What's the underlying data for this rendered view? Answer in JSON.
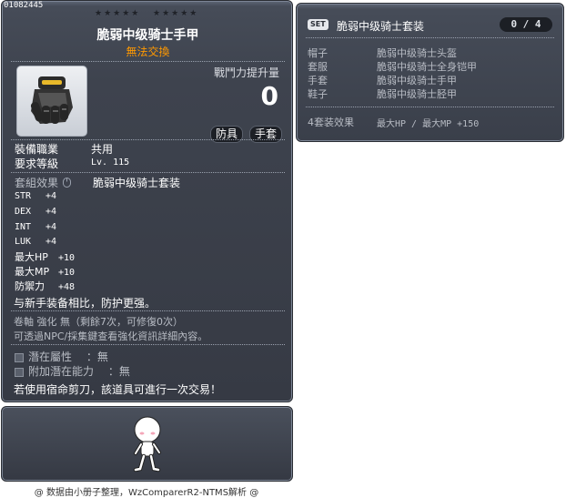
{
  "item_id": "01082445",
  "stars_left": "★★★★★",
  "stars_right": "★★★★★",
  "title": "脆弱中级骑士手甲",
  "untradeable": "無法交換",
  "power": {
    "label": "戰鬥力提升量",
    "value": "0"
  },
  "tags": {
    "armor": "防具",
    "gloves": "手套"
  },
  "job": {
    "label": "裝備職業",
    "value": "共用"
  },
  "level": {
    "label": "要求等級",
    "value": "Lv. 115"
  },
  "set_effect": {
    "label": "套組效果",
    "value": "脆弱中级骑士套装"
  },
  "stats": [
    {
      "name": "STR",
      "value": "+4"
    },
    {
      "name": "DEX",
      "value": "+4"
    },
    {
      "name": "INT",
      "value": "+4"
    },
    {
      "name": "LUK",
      "value": "+4"
    },
    {
      "name": "最大HP",
      "value": "+10"
    },
    {
      "name": "最大MP",
      "value": "+10"
    },
    {
      "name": "防禦力",
      "value": "+48"
    }
  ],
  "compare_text": "与新手装备相比，防护更强。",
  "scroll_text": "卷軸 強化 無（剩餘7次，可修復0次）",
  "npc_text": "可透過NPC/採集鍵查看強化資訊詳細內容。",
  "potential": {
    "label": "潛在屬性",
    "value": "：無"
  },
  "bonus_potential": {
    "label": "附加潛在能力",
    "value": "：無"
  },
  "scissors_text": "若使用宿命剪刀，該道具可進行一次交易！",
  "footer": "@ 数据由小册子整理，WzComparerR2-NTMS解析 @",
  "set": {
    "badge": "SET",
    "title": "脆弱中级骑士套装",
    "count": "0 / 4",
    "items": [
      {
        "slot": "帽子",
        "piece": "脆弱中级骑士头盔"
      },
      {
        "slot": "套服",
        "piece": "脆弱中级骑士全身铠甲"
      },
      {
        "slot": "手套",
        "piece": "脆弱中级骑士手甲"
      },
      {
        "slot": "鞋子",
        "piece": "脆弱中级骑士胫甲"
      }
    ],
    "effect_label": "4套装效果",
    "effect_value": "最大HP / 最大MP  +150"
  }
}
